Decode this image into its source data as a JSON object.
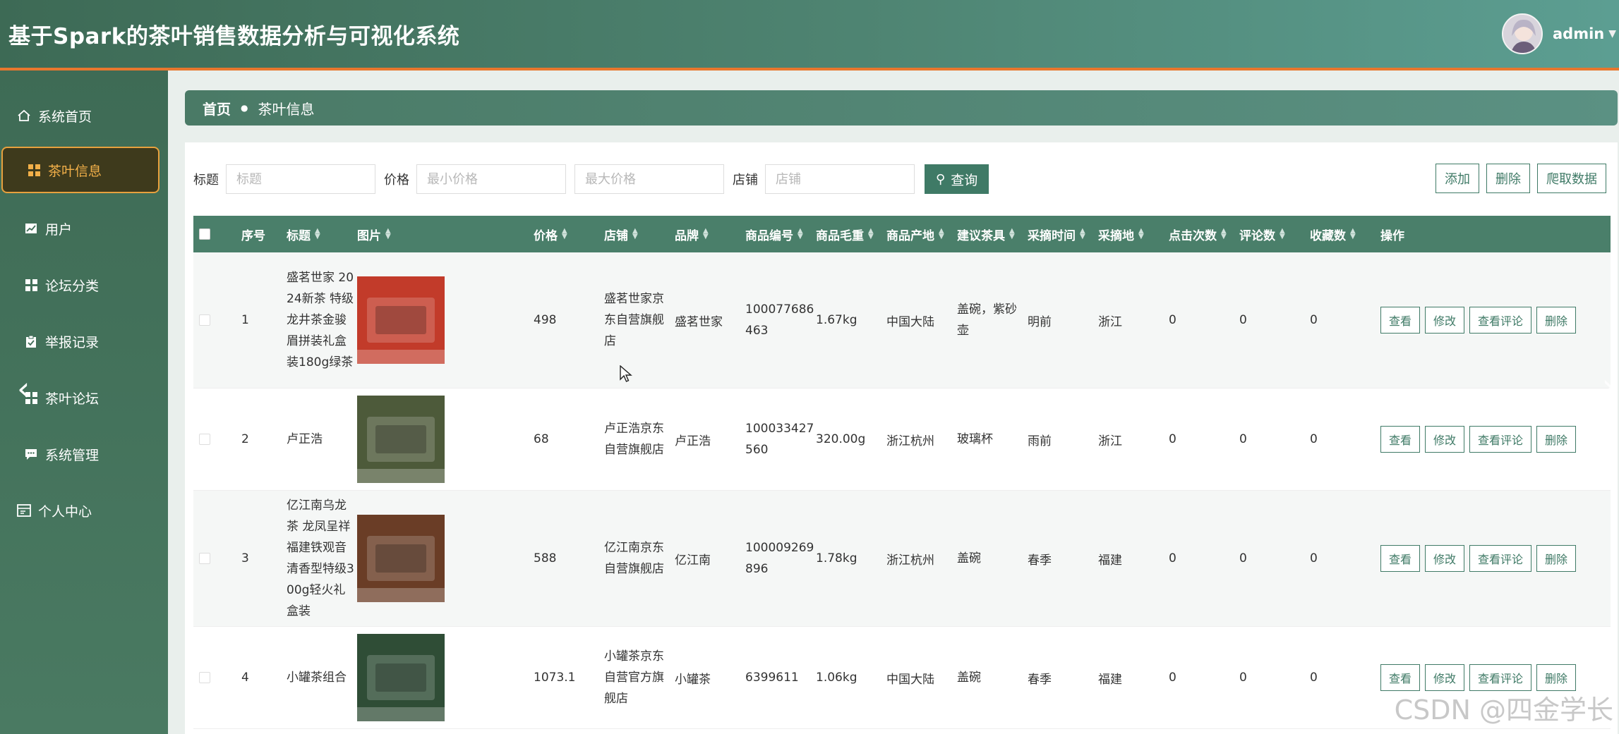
{
  "header": {
    "title": "基于Spark的茶叶销售数据分析与可视化系统",
    "username": "admin"
  },
  "sidebar": {
    "items": [
      {
        "label": "系统首页",
        "icon": "home-icon"
      },
      {
        "label": "茶叶信息",
        "icon": "grid-icon",
        "active": true
      },
      {
        "label": "用户",
        "icon": "chart-icon"
      },
      {
        "label": "论坛分类",
        "icon": "grid-icon"
      },
      {
        "label": "举报记录",
        "icon": "clipboard-icon"
      },
      {
        "label": "茶叶论坛",
        "icon": "grid-icon"
      },
      {
        "label": "系统管理",
        "icon": "chat-icon"
      },
      {
        "label": "个人中心",
        "icon": "profile-icon"
      }
    ]
  },
  "breadcrumb": {
    "home": "首页",
    "current": "茶叶信息"
  },
  "search": {
    "title_label": "标题",
    "title_placeholder": "标题",
    "price_label": "价格",
    "min_price_placeholder": "最小价格",
    "max_price_placeholder": "最大价格",
    "shop_label": "店铺",
    "shop_placeholder": "店铺",
    "query_button": "查询"
  },
  "actions": {
    "add": "添加",
    "delete": "删除",
    "crawl": "爬取数据"
  },
  "table": {
    "headers": {
      "index": "序号",
      "title": "标题",
      "image": "图片",
      "price": "价格",
      "shop": "店铺",
      "brand": "品牌",
      "product_id": "商品编号",
      "weight": "商品毛重",
      "origin": "商品产地",
      "teaware": "建议茶具",
      "pick_time": "采摘时间",
      "pick_place": "采摘地",
      "clicks": "点击次数",
      "comments": "评论数",
      "favorites": "收藏数",
      "operations": "操作"
    },
    "row_actions": {
      "view": "查看",
      "edit": "修改",
      "view_comments": "查看评论",
      "delete": "删除"
    },
    "rows": [
      {
        "index": "1",
        "title": "盛茗世家 2024新茶 特级龙井茶金骏眉拼装礼盒装180g绿茶",
        "price": "498",
        "shop": "盛茗世家京东自营旗舰店",
        "brand": "盛茗世家",
        "product_id": "100077686463",
        "weight": "1.67kg",
        "origin": "中国大陆",
        "teaware": "盖碗，紫砂壶",
        "pick_time": "明前",
        "pick_place": "浙江",
        "clicks": "0",
        "comments": "0",
        "favorites": "0",
        "image_color": "#c23b2a"
      },
      {
        "index": "2",
        "title": "卢正浩",
        "price": "68",
        "shop": "卢正浩京东自营旗舰店",
        "brand": "卢正浩",
        "product_id": "100033427560",
        "weight": "320.00g",
        "origin": "浙江杭州",
        "teaware": "玻璃杯",
        "pick_time": "雨前",
        "pick_place": "浙江",
        "clicks": "0",
        "comments": "0",
        "favorites": "0",
        "image_color": "#4d5a3a"
      },
      {
        "index": "3",
        "title": "亿江南乌龙茶 龙凤呈祥 福建铁观音 清香型特级300g轻火礼盒装",
        "price": "588",
        "shop": "亿江南京东自营旗舰店",
        "brand": "亿江南",
        "product_id": "100009269896",
        "weight": "1.78kg",
        "origin": "浙江杭州",
        "teaware": "盖碗",
        "pick_time": "春季",
        "pick_place": "福建",
        "clicks": "0",
        "comments": "0",
        "favorites": "0",
        "image_color": "#6a3d26"
      },
      {
        "index": "4",
        "title": "小罐茶组合",
        "price": "1073.1",
        "shop": "小罐茶京东自营官方旗舰店",
        "brand": "小罐茶",
        "product_id": "6399611",
        "weight": "1.06kg",
        "origin": "中国大陆",
        "teaware": "盖碗",
        "pick_time": "春季",
        "pick_place": "福建",
        "clicks": "0",
        "comments": "0",
        "favorites": "0",
        "image_color": "#2f4d36"
      }
    ]
  },
  "watermark": "CSDN @四金学长"
}
